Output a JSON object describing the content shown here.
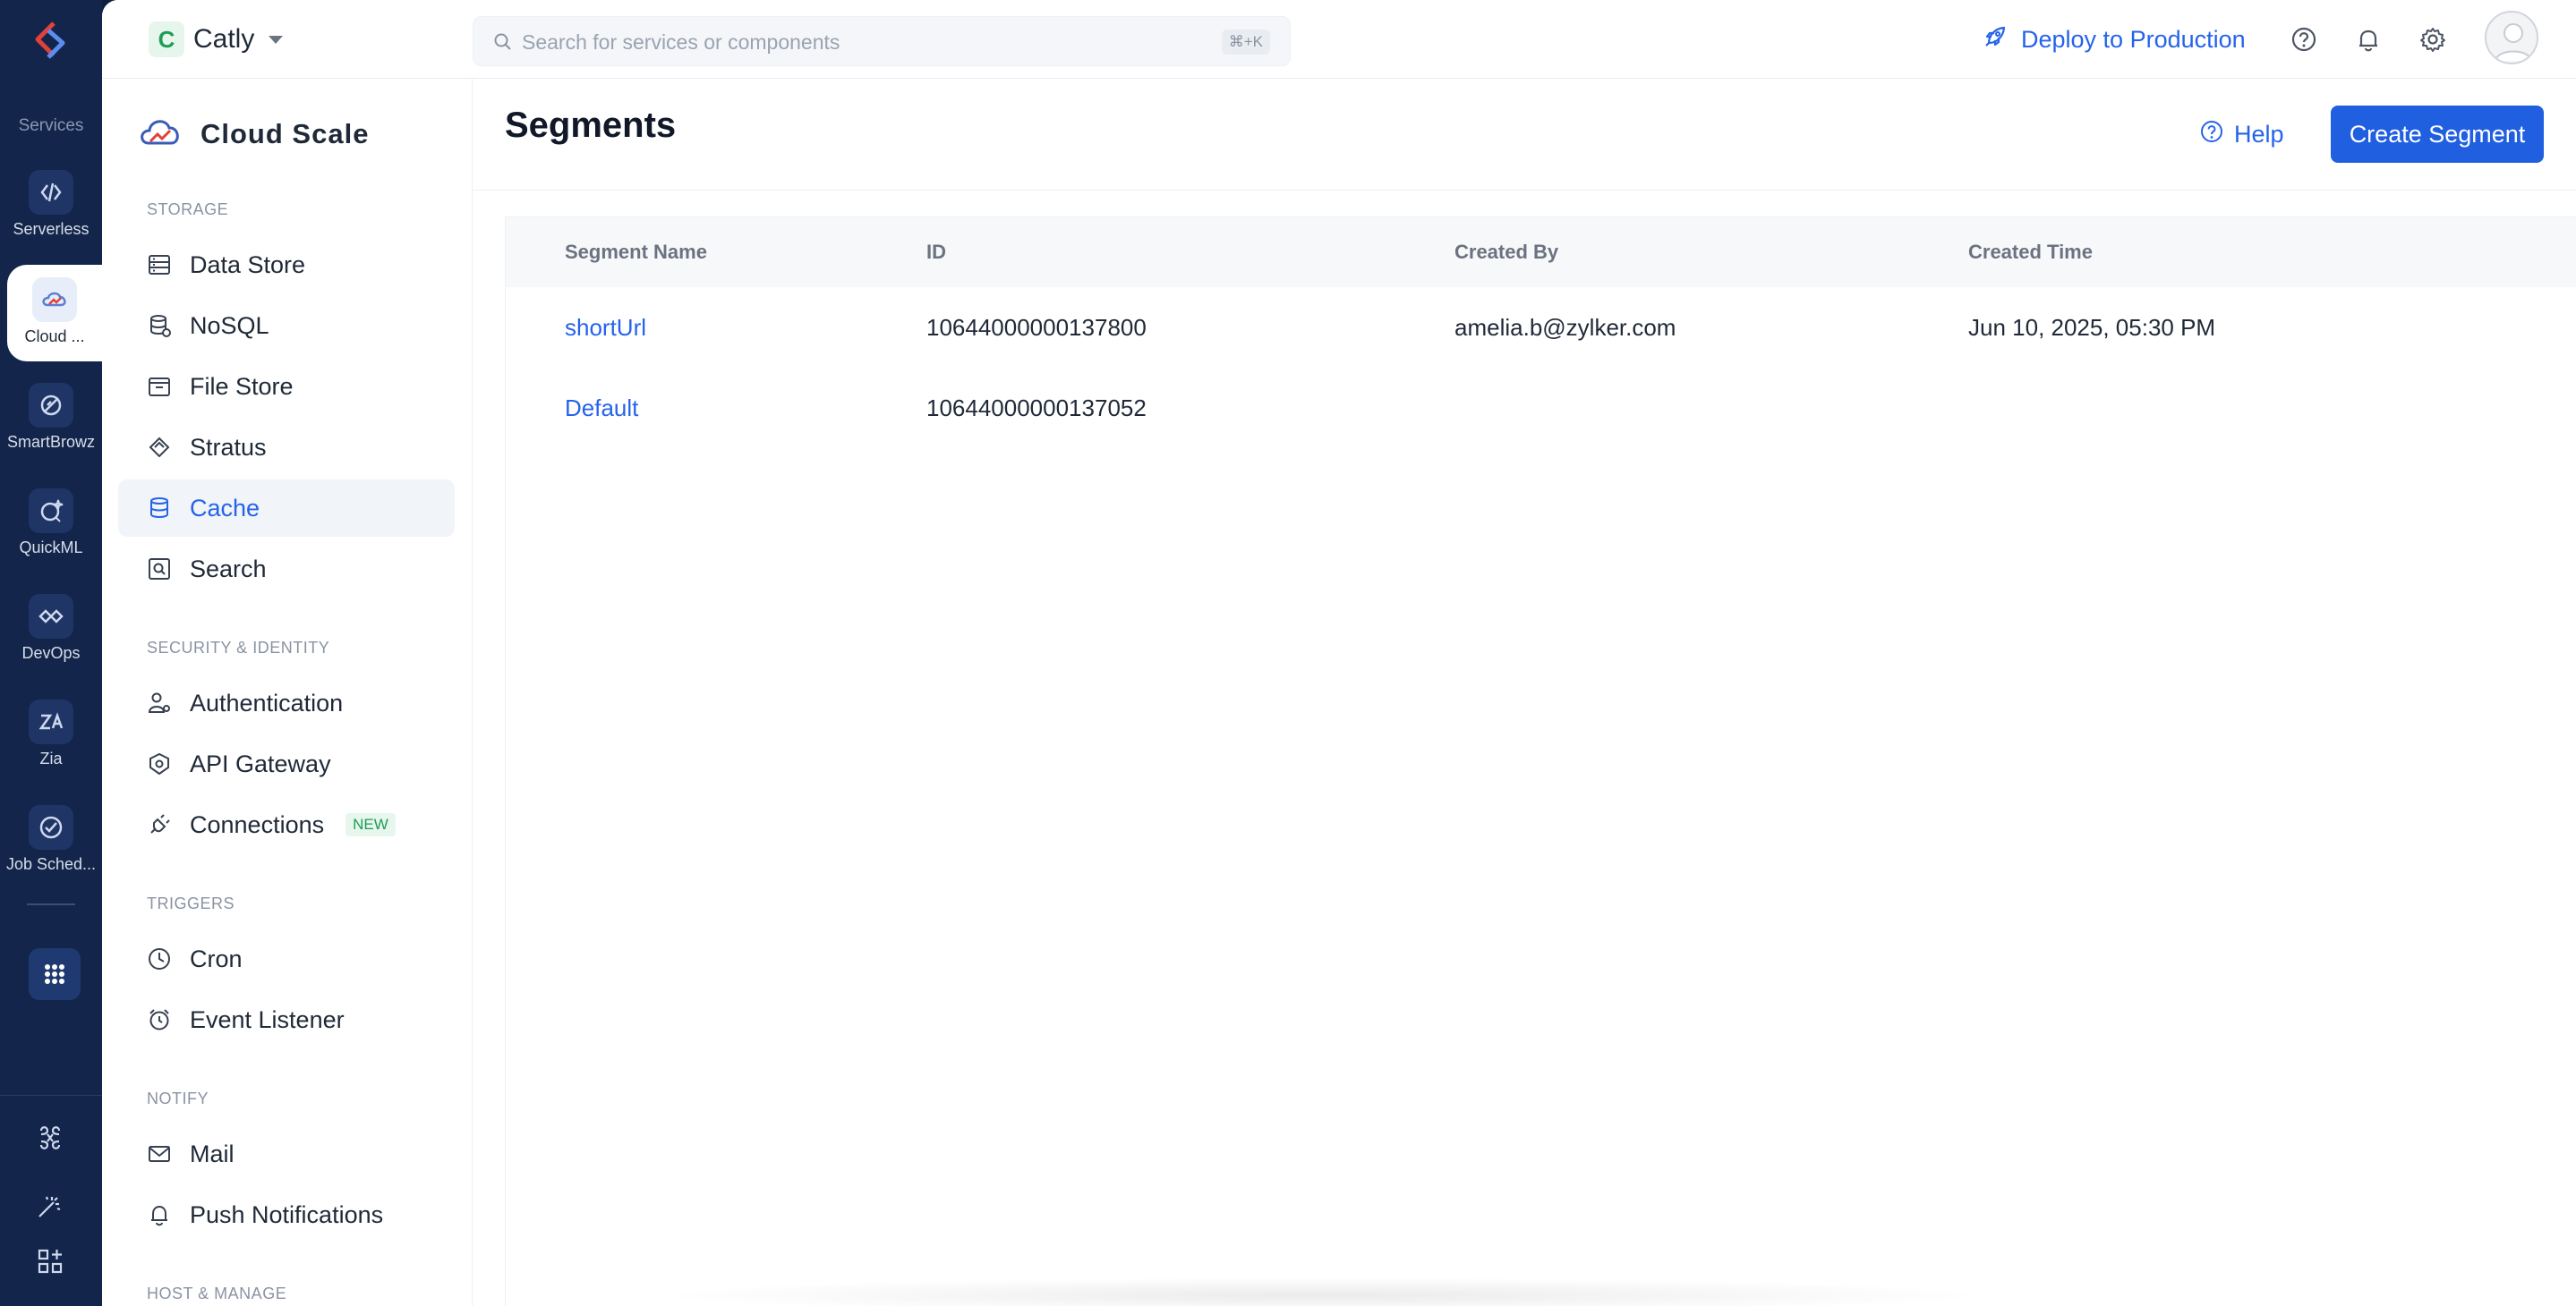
{
  "rail": {
    "services_label": "Services",
    "items": [
      {
        "label": "Serverless",
        "icon": "serverless-icon"
      },
      {
        "label": "Cloud ...",
        "icon": "cloud-scale-icon",
        "active": true
      },
      {
        "label": "SmartBrowz",
        "icon": "smartbrowz-icon"
      },
      {
        "label": "QuickML",
        "icon": "quickml-icon"
      },
      {
        "label": "DevOps",
        "icon": "devops-icon"
      },
      {
        "label": "Zia",
        "icon": "zia-icon"
      },
      {
        "label": "Job Sched...",
        "icon": "job-scheduling-icon"
      }
    ]
  },
  "topbar": {
    "project_initial": "C",
    "project_name": "Catly",
    "search_placeholder": "Search for services or components",
    "search_shortcut": "⌘+K",
    "deploy_label": "Deploy to Production"
  },
  "sidenav": {
    "brand": "Cloud Scale",
    "sections": {
      "storage": "STORAGE",
      "security": "SECURITY & IDENTITY",
      "triggers": "TRIGGERS",
      "notify": "NOTIFY",
      "host": "HOST & MANAGE"
    },
    "items": {
      "data_store": "Data Store",
      "nosql": "NoSQL",
      "file_store": "File Store",
      "stratus": "Stratus",
      "cache": "Cache",
      "search": "Search",
      "authentication": "Authentication",
      "api_gateway": "API Gateway",
      "connections": "Connections",
      "connections_badge": "NEW",
      "cron": "Cron",
      "event_listener": "Event Listener",
      "mail": "Mail",
      "push_notifications": "Push Notifications"
    }
  },
  "main": {
    "title": "Segments",
    "help_label": "Help",
    "create_label": "Create Segment",
    "columns": [
      "Segment Name",
      "ID",
      "Created By",
      "Created Time"
    ],
    "rows": [
      {
        "name": "shortUrl",
        "id": "10644000000137800",
        "created_by": "amelia.b@zylker.com",
        "created_time": "Jun 10, 2025, 05:30 PM"
      },
      {
        "name": "Default",
        "id": "10644000000137052",
        "created_by": "",
        "created_time": ""
      }
    ]
  },
  "colors": {
    "rail_bg": "#13254a",
    "accent": "#2563eb",
    "primary_button": "#1f5fe0",
    "new_badge": "#1f9d55"
  }
}
